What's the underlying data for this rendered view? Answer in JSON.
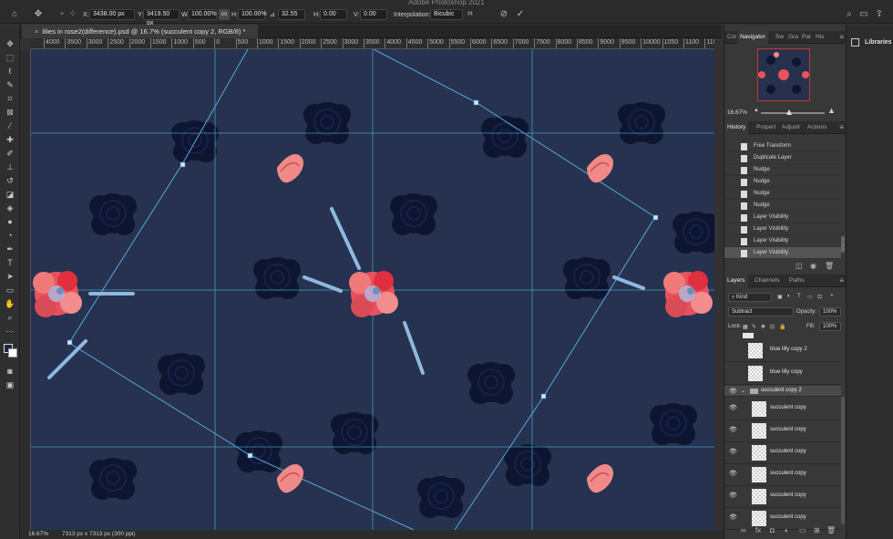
{
  "app": {
    "title": "Adobe Photoshop 2021"
  },
  "options_bar": {
    "x_label": "X:",
    "x_value": "3438.00 px",
    "y_label": "Y:",
    "y_value": "3419.50 px",
    "w_label": "W:",
    "w_value": "100.00%",
    "h_label": "H:",
    "h_value": "100.00%",
    "angle_label": "⊿",
    "angle_value": "32.55",
    "hskew_label": "H:",
    "hskew_value": "0.00",
    "vskew_label": "V:",
    "vskew_value": "0.00",
    "interp_label": "Interpolation:",
    "interp_value": "Bicubic"
  },
  "document": {
    "tab_title": "lilies in rose2(difference).psd @ 16.7% (succulent copy 2, RGB/8) *",
    "close_glyph": "×"
  },
  "ruler": {
    "labels": [
      "4000",
      "3500",
      "3000",
      "2500",
      "2000",
      "1500",
      "1000",
      "500",
      "0",
      "500",
      "1000",
      "1500",
      "2000",
      "2500",
      "3000",
      "3500",
      "4000",
      "4500",
      "5000",
      "5500",
      "6000",
      "6500",
      "7000",
      "7500",
      "8000",
      "8500",
      "9000",
      "9500",
      "10000",
      "1050",
      "1100",
      "1150"
    ]
  },
  "status": {
    "zoom": "16.67%",
    "doc_info": "7313 px x 7313 px (300 ppi)"
  },
  "navigator": {
    "tabs": [
      "Col",
      "Navigator",
      "Sw",
      "Gra",
      "Pat",
      "His"
    ],
    "active_tab": "Navigator",
    "zoom": "16.67%"
  },
  "history": {
    "tabs": [
      "History",
      "Propert",
      "Adjustr",
      "Actions"
    ],
    "active_tab": "History",
    "items": [
      {
        "label": "Free Transform",
        "selected": false
      },
      {
        "label": "Duplicate Layer",
        "selected": false
      },
      {
        "label": "Nudge",
        "selected": false
      },
      {
        "label": "Nudge",
        "selected": false
      },
      {
        "label": "Nudge",
        "selected": false
      },
      {
        "label": "Nudge",
        "selected": false
      },
      {
        "label": "Layer Visibility",
        "selected": false
      },
      {
        "label": "Layer Visibility",
        "selected": false
      },
      {
        "label": "Layer Visibility",
        "selected": false
      },
      {
        "label": "Layer Visibility",
        "selected": true
      }
    ]
  },
  "layers": {
    "tabs": [
      "Layers",
      "Channels",
      "Paths"
    ],
    "active_tab": "Layers",
    "filter_placeholder": "Kind",
    "blend_mode": "Subtract",
    "opacity_label": "Opacity:",
    "opacity_value": "100%",
    "lock_label": "Lock:",
    "fill_label": "Fill:",
    "fill_value": "100%",
    "group_name": "succulent copy 2",
    "items_top": [
      {
        "name": "blue lilly copy 2",
        "visible": false
      },
      {
        "name": "blue lilly copy",
        "visible": false
      }
    ],
    "items_group": [
      {
        "name": "succulent copy",
        "visible": true
      },
      {
        "name": "succulent copy",
        "visible": true
      },
      {
        "name": "succulent copy",
        "visible": true
      },
      {
        "name": "succulent copy",
        "visible": true
      },
      {
        "name": "succulent copy",
        "visible": true
      },
      {
        "name": "succulent copy",
        "visible": true
      }
    ]
  },
  "libraries": {
    "label": "Libraries"
  },
  "colors": {
    "canvas_bg": "#26324f",
    "guide": "#4fb6d8",
    "accent_rose": "#ee5a66"
  }
}
